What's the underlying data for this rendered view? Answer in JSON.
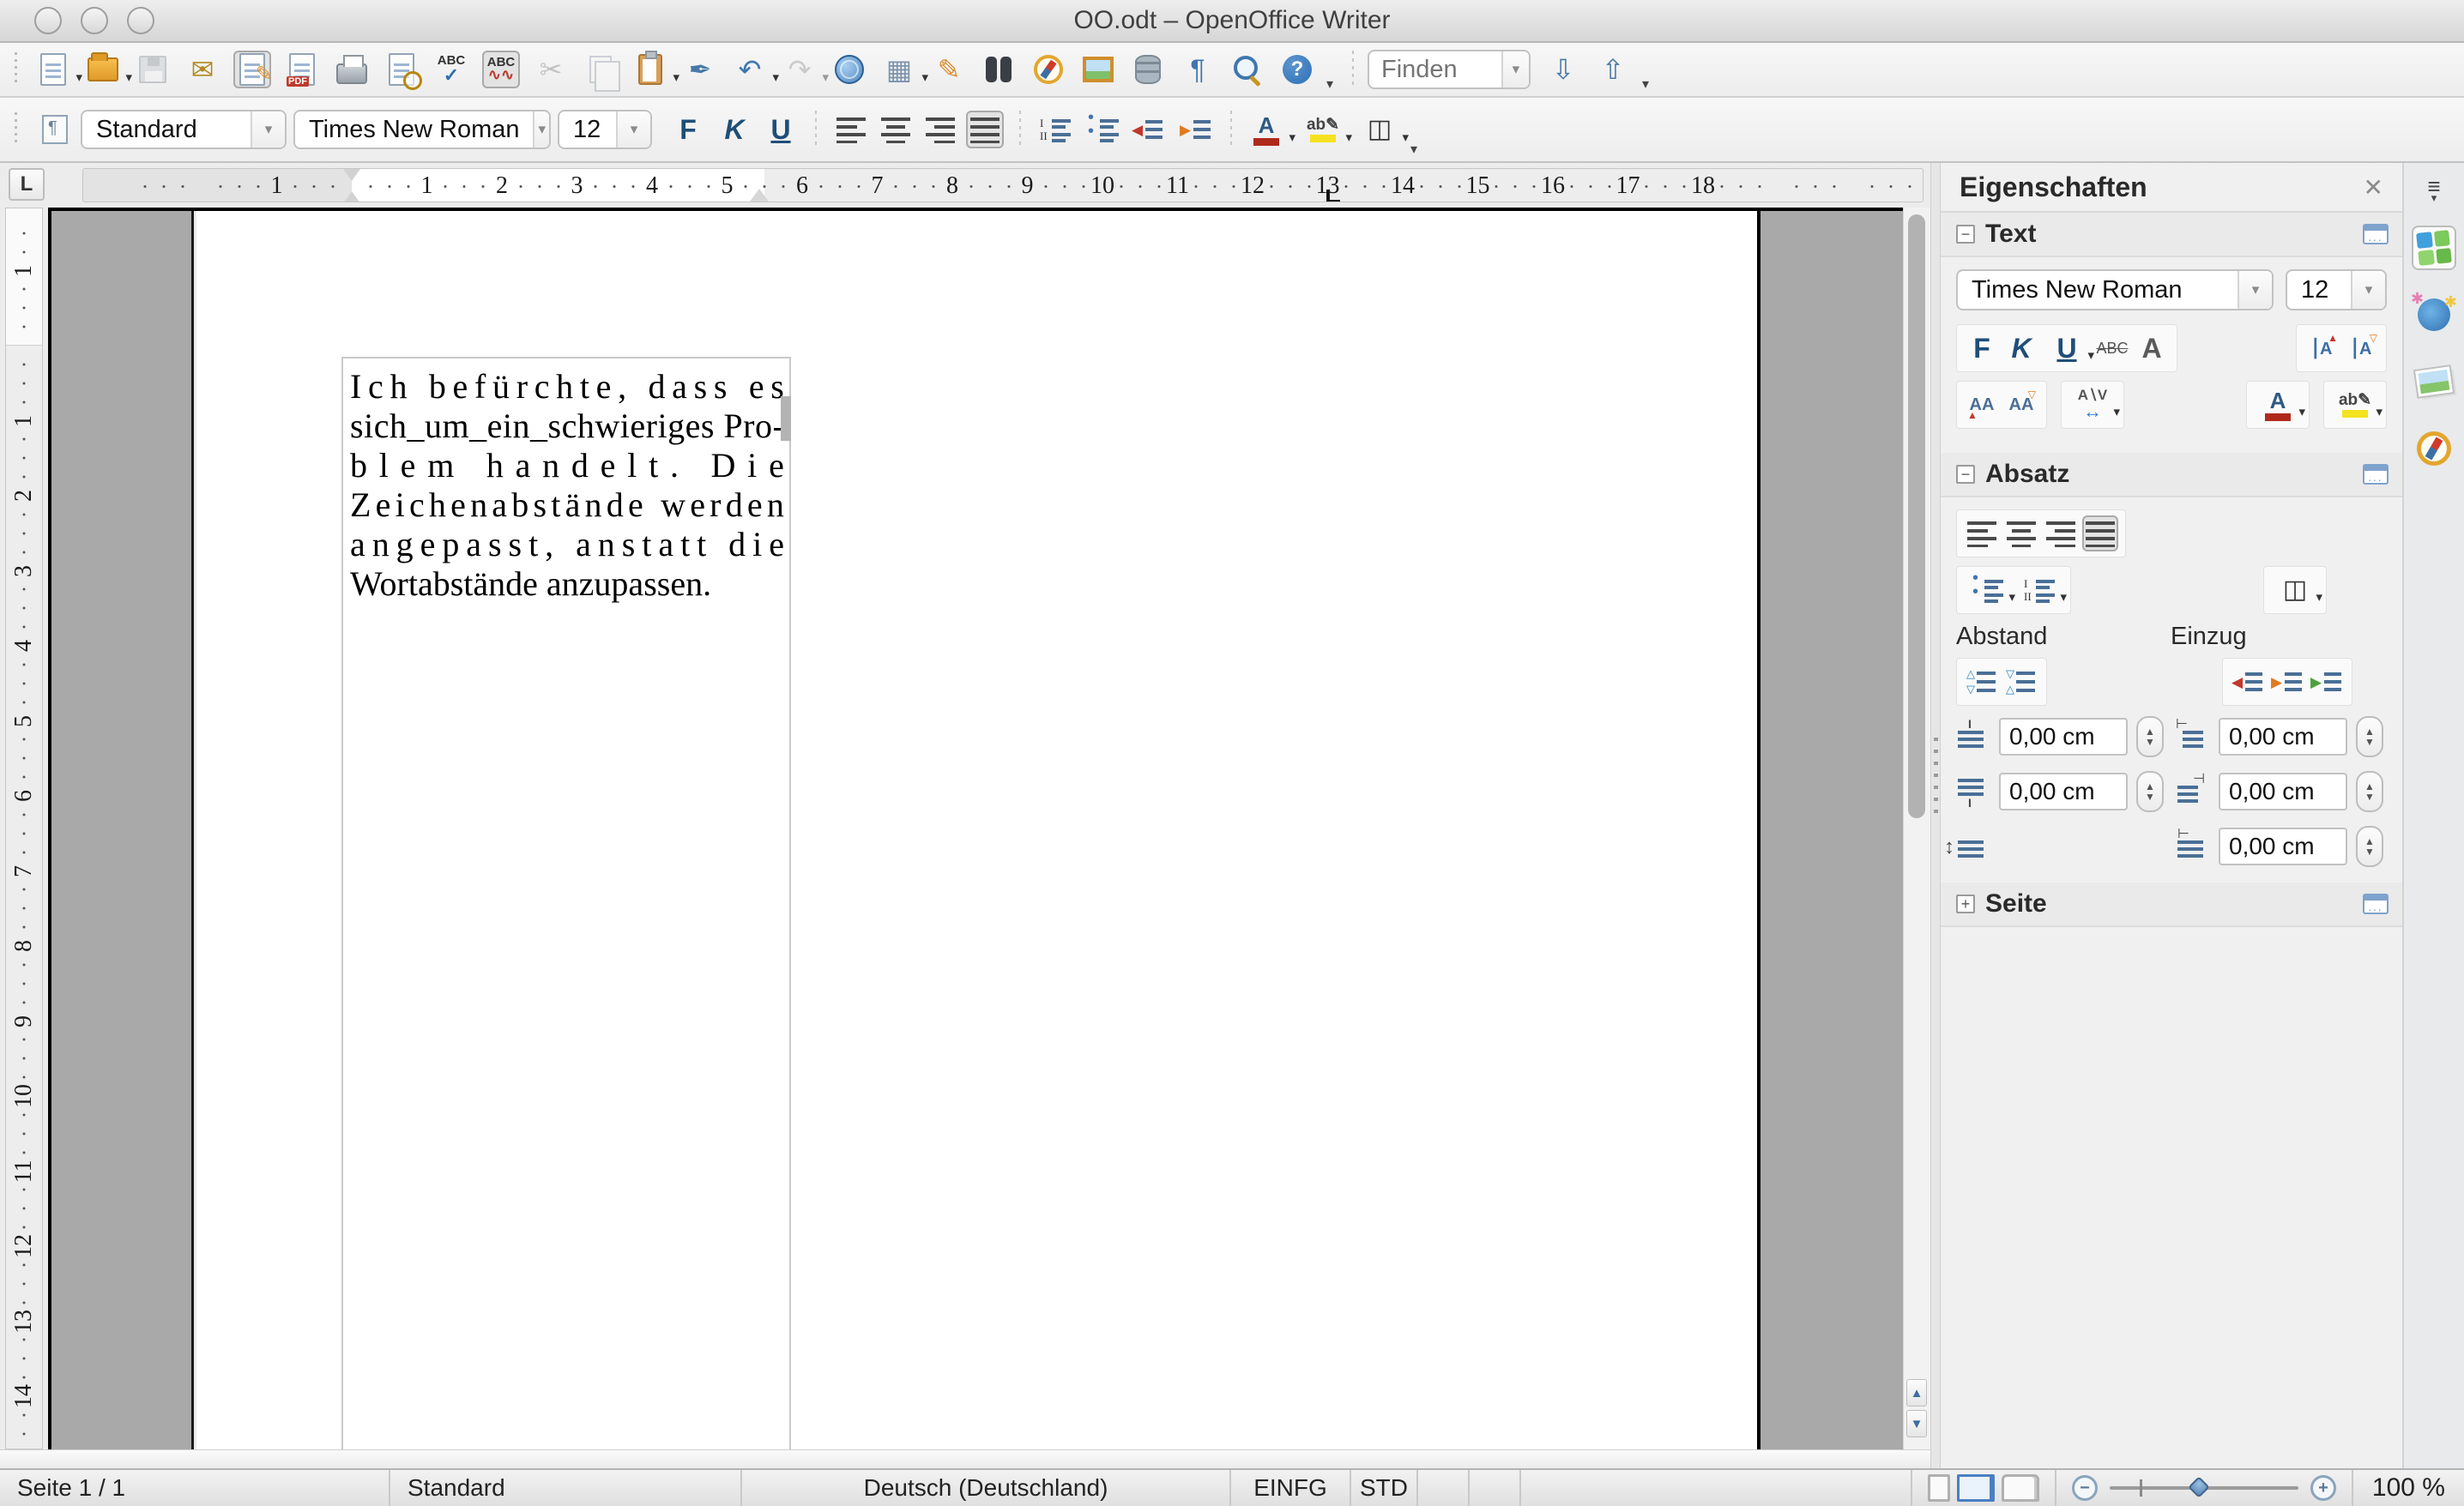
{
  "window": {
    "title": "OO.odt – OpenOffice Writer"
  },
  "toolbar_standard": {
    "main_icons": [
      {
        "n": "new-document-button",
        "cls": "i-sheet",
        "dd": 1
      },
      {
        "n": "open-button",
        "cls": "i-folder",
        "dd": 1
      },
      {
        "n": "save-button",
        "cls": "i-floppy",
        "dis": 1
      },
      {
        "n": "email-document-button",
        "g": "✉",
        "c": "#b08a20"
      },
      {
        "n": "edit-file-button",
        "cls": "i-edit",
        "act": 1
      },
      {
        "n": "export-pdf-button",
        "cls": "i-pdf"
      },
      {
        "n": "print-button",
        "cls": "i-printer"
      },
      {
        "n": "page-preview-button",
        "cls": "i-preview"
      },
      {
        "n": "spellcheck-button",
        "cls": "i-abc-ok"
      },
      {
        "n": "auto-spellcheck-button",
        "cls": "i-abc-wave",
        "act": 1
      },
      {
        "n": "cut-button",
        "g": "✂",
        "c": "#8a8a8a",
        "dis": 1
      },
      {
        "n": "copy-button",
        "cls": "i-copy",
        "dis": 1
      },
      {
        "n": "paste-button",
        "cls": "i-clip",
        "dd": 1
      },
      {
        "n": "format-paintbrush-button",
        "g": "✒",
        "c": "#4878a8"
      },
      {
        "n": "undo-button",
        "g": "↶",
        "c": "#3f76b0",
        "dd": 1
      },
      {
        "n": "redo-button",
        "g": "↷",
        "c": "#9a9a9a",
        "dis": 1,
        "dd": 1
      },
      {
        "n": "hyperlink-button",
        "cls": "i-globe"
      },
      {
        "n": "table-button",
        "g": "▦",
        "c": "#7d93ab",
        "dd": 1
      },
      {
        "n": "draw-functions-button",
        "g": "✎",
        "c": "#d98b2b"
      },
      {
        "n": "find-replace-button",
        "cls": "i-binoc"
      },
      {
        "n": "navigator-button",
        "cls": "i-compass"
      },
      {
        "n": "gallery-button",
        "cls": "i-picture"
      },
      {
        "n": "data-sources-button",
        "cls": "i-database"
      },
      {
        "n": "formatting-marks-button",
        "g": "¶",
        "c": "#3f76b0"
      },
      {
        "n": "zoom-button",
        "cls": "i-zoom"
      },
      {
        "n": "help-button",
        "cls": "i-help"
      }
    ],
    "find_icons": [
      {
        "n": "find-next-button",
        "g": "⇩",
        "c": "#4878a8"
      },
      {
        "n": "find-previous-button",
        "g": "⇧",
        "c": "#4878a8"
      }
    ]
  },
  "find": {
    "placeholder": "Finden"
  },
  "toolbar_format": {
    "paragraph_style": "Standard",
    "font_name": "Times New Roman",
    "font_size": "12",
    "icons_text": [
      {
        "n": "bold-button",
        "g": "F",
        "c": "#1f4e79",
        "b": 1
      },
      {
        "n": "italic-button",
        "g": "K",
        "c": "#1f4e79",
        "b": 1,
        "i": 1
      },
      {
        "n": "underline-button",
        "g": "U",
        "c": "#1f4e79",
        "b": 1,
        "u": 1
      }
    ],
    "icons_align": [
      {
        "n": "align-left-button",
        "cls": "i-align-l al"
      },
      {
        "n": "align-center-button",
        "cls": "i-align-c al"
      },
      {
        "n": "align-right-button",
        "cls": "i-align-r al"
      },
      {
        "n": "justify-button",
        "cls": "i-align-j al",
        "act": 1
      }
    ],
    "icons_lists": [
      {
        "n": "numbered-list-button",
        "cls": "i-list-n"
      },
      {
        "n": "bullet-list-button",
        "cls": "i-list-b"
      }
    ],
    "icons_indent": [
      {
        "n": "decrease-indent-button",
        "cls": "i-ind-dec"
      },
      {
        "n": "increase-indent-button",
        "cls": "i-ind-inc"
      }
    ],
    "icons_color": [
      {
        "n": "font-color-button",
        "cls": "i-fontcol",
        "dd": 1
      },
      {
        "n": "highlighting-button",
        "cls": "i-hilite",
        "dd": 1
      },
      {
        "n": "background-color-button",
        "cls": "i-bgcol",
        "dd": 1
      }
    ]
  },
  "ruler_h": {
    "margin_label": "1",
    "numbers": [
      1,
      2,
      3,
      4,
      5,
      6,
      7,
      8,
      9,
      10,
      11,
      12,
      13,
      14,
      15,
      16,
      17,
      18
    ]
  },
  "ruler_v": {
    "margin_label": "1",
    "numbers": [
      1,
      2,
      3,
      4,
      5,
      6,
      7,
      8,
      9,
      10,
      11,
      12,
      13,
      14
    ]
  },
  "document": {
    "lines": [
      "Ich befürchte, dass es",
      "sich_um_ein_schwieriges Pro-",
      "blem handelt. Die",
      "Zeichenabstände werden",
      "angepasst, anstatt die",
      "Wortabstände anzupassen."
    ]
  },
  "sidebar": {
    "title": "Eigenschaften",
    "close_icon": "✕",
    "text_section": {
      "label": "Text",
      "font_name": "Times New Roman",
      "font_size": "12",
      "group_format": [
        {
          "n": "sidebar-bold-button",
          "g": "F",
          "c": "#1f4e79",
          "b": 1
        },
        {
          "n": "sidebar-italic-button",
          "g": "K",
          "c": "#1f4e79",
          "b": 1,
          "i": 1
        },
        {
          "n": "sidebar-underline-button",
          "g": "U",
          "c": "#1f4e79",
          "b": 1,
          "u": 1,
          "dd": 1
        },
        {
          "n": "sidebar-strikethrough-button",
          "g": "ABC",
          "c": "#555",
          "s": 1,
          "sm": 1
        },
        {
          "n": "sidebar-character-dialog-button",
          "g": "A",
          "c": "#5a5a5a",
          "b": 1
        }
      ],
      "group_size": [
        {
          "n": "increase-font-size-button",
          "cls": "i-rAup"
        },
        {
          "n": "decrease-font-size-button",
          "cls": "i-rAdn"
        }
      ],
      "group_grow": [
        {
          "n": "grow-font-button",
          "cls": "i-Aup"
        },
        {
          "n": "shrink-font-button",
          "cls": "i-Adn"
        }
      ],
      "group_spacing": [
        {
          "n": "character-spacing-button",
          "cls": "i-AV",
          "dd": 1
        }
      ],
      "group_fontcolor": [
        {
          "n": "sidebar-font-color-button",
          "cls": "i-fontcol",
          "dd": 1
        }
      ],
      "group_highlight": [
        {
          "n": "sidebar-highlighting-button",
          "cls": "i-hilite",
          "dd": 1
        }
      ]
    },
    "paragraph_section": {
      "label": "Absatz",
      "spacing_label": "Abstand",
      "indent_label": "Einzug",
      "group_align": [
        {
          "n": "sidebar-align-left-button",
          "cls": "i-align-l al"
        },
        {
          "n": "sidebar-align-center-button",
          "cls": "i-align-c al"
        },
        {
          "n": "sidebar-align-right-button",
          "cls": "i-align-r al"
        },
        {
          "n": "sidebar-justify-button",
          "cls": "i-align-j al",
          "act": 1
        }
      ],
      "group_lists": [
        {
          "n": "sidebar-bullet-list-button",
          "cls": "i-list-b",
          "dd": 1
        },
        {
          "n": "sidebar-numbered-list-button",
          "cls": "i-list-n",
          "dd": 1
        }
      ],
      "group_background": [
        {
          "n": "paragraph-background-color-button",
          "cls": "i-bgcol",
          "dd": 1
        }
      ],
      "group_spacing_btns": [
        {
          "n": "increase-paragraph-spacing-button",
          "cls": "i-sp-inc"
        },
        {
          "n": "decrease-paragraph-spacing-button",
          "cls": "i-sp-dec"
        }
      ],
      "group_indent_btns": [
        {
          "n": "sidebar-increase-indent-button",
          "cls": "i-ind-dec"
        },
        {
          "n": "sidebar-decrease-indent-button",
          "cls": "i-ind-inc"
        },
        {
          "n": "hanging-indent-button",
          "cls": "i-ind-hang"
        }
      ],
      "spin": {
        "above": "0,00 cm",
        "below": "0,00 cm",
        "before": "0,00 cm",
        "after": "0,00 cm",
        "firstline": "0,00 cm"
      }
    },
    "page_section": {
      "label": "Seite"
    }
  },
  "statusbar": {
    "page": "Seite 1 / 1",
    "style": "Standard",
    "language": "Deutsch (Deutschland)",
    "insert_mode": "EINFG",
    "selection_mode": "STD",
    "zoom": "100 %"
  }
}
